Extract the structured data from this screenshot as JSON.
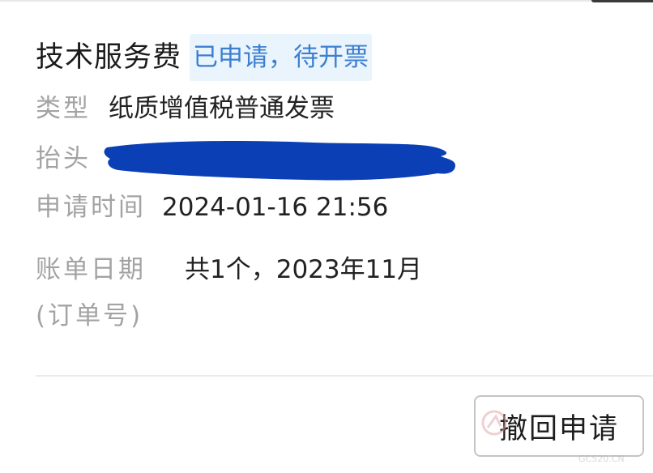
{
  "order": {
    "title": "技术服务费",
    "status": "已申请，待开票"
  },
  "details": {
    "type_label": "类型",
    "type_value": "纸质增值税普通发票",
    "header_label": "抬头",
    "apply_time_label": "申请时间",
    "apply_time_value": "2024-01-16 21:56",
    "bill_date_label": "账单日期",
    "bill_date_value": "共1个，2023年11月",
    "order_no_label": "(订单号)"
  },
  "actions": {
    "withdraw_label": "撤回申请"
  },
  "watermark": {
    "text": "GC520.CN"
  },
  "colors": {
    "status_text": "#3c7fd1",
    "status_bg": "#eaf4fd",
    "redaction": "#0a3fb5",
    "label_text": "#a3a3a3"
  }
}
